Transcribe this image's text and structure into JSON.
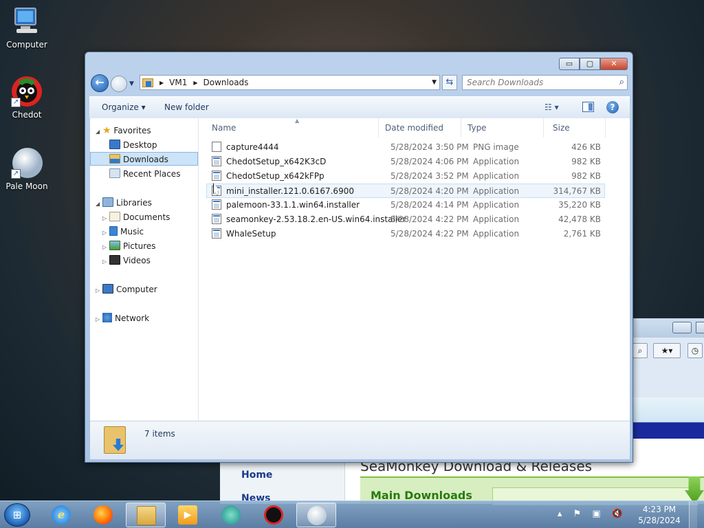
{
  "desktop": {
    "icons": [
      {
        "label": "Computer"
      },
      {
        "label": "Chedot"
      },
      {
        "label": "Pale Moon"
      }
    ]
  },
  "background_window": {
    "nav_home": "Home",
    "nav_news": "News",
    "heading": "SeaMonkey Download & Releases",
    "main_downloads": "Main Downloads"
  },
  "explorer": {
    "window_controls": {
      "minimize": "▭",
      "maximize": "▢",
      "close": "✕"
    },
    "address": {
      "crumbs": [
        "VM1",
        "Downloads"
      ],
      "search_placeholder": "Search Downloads"
    },
    "commands": {
      "organize": "Organize ▾",
      "new_folder": "New folder"
    },
    "nav_pane": {
      "favorites": "Favorites",
      "desktop": "Desktop",
      "downloads": "Downloads",
      "recent_places": "Recent Places",
      "libraries": "Libraries",
      "documents": "Documents",
      "music": "Music",
      "pictures": "Pictures",
      "videos": "Videos",
      "computer": "Computer",
      "network": "Network"
    },
    "columns": {
      "name": "Name",
      "date_modified": "Date modified",
      "type": "Type",
      "size": "Size"
    },
    "files": [
      {
        "name": "capture4444",
        "date": "5/28/2024 3:50 PM",
        "type": "PNG image",
        "size": "426 KB"
      },
      {
        "name": "ChedotSetup_x642K3cD",
        "date": "5/28/2024 4:06 PM",
        "type": "Application",
        "size": "982 KB"
      },
      {
        "name": "ChedotSetup_x642kFPp",
        "date": "5/28/2024 3:52 PM",
        "type": "Application",
        "size": "982 KB"
      },
      {
        "name": "mini_installer.121.0.6167.6900",
        "date": "5/28/2024 4:20 PM",
        "type": "Application",
        "size": "314,767 KB"
      },
      {
        "name": "palemoon-33.1.1.win64.installer",
        "date": "5/28/2024 4:14 PM",
        "type": "Application",
        "size": "35,220 KB"
      },
      {
        "name": "seamonkey-2.53.18.2.en-US.win64.installer",
        "date": "5/28/2024 4:22 PM",
        "type": "Application",
        "size": "42,478 KB"
      },
      {
        "name": "WhaleSetup",
        "date": "5/28/2024 4:22 PM",
        "type": "Application",
        "size": "2,761 KB"
      }
    ],
    "status": {
      "item_count": "7 items"
    }
  },
  "taskbar": {
    "clock_time": "4:23 PM",
    "clock_date": "5/28/2024"
  }
}
